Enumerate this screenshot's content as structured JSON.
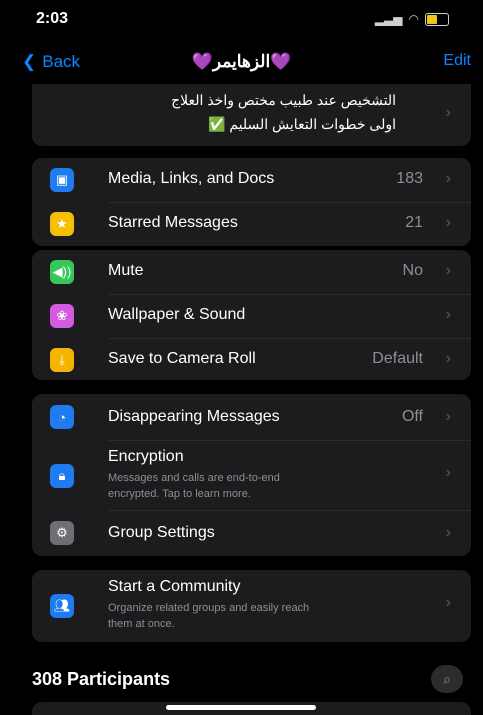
{
  "status": {
    "time": "2:03"
  },
  "nav": {
    "back_label": "Back",
    "title": "💜الزهايمر💜",
    "edit_label": "Edit"
  },
  "description": {
    "line1": "التشخيص عند طبيب مختص واخذ العلاج",
    "line2": "اولى خطوات التعايش السليم ✅"
  },
  "media_section": [
    {
      "label": "Media, Links, and Docs",
      "value": "183",
      "icon": "photo-icon",
      "color": "#1e7cf0"
    },
    {
      "label": "Starred Messages",
      "value": "21",
      "icon": "star-icon",
      "color": "#f5c000"
    }
  ],
  "settings_section": [
    {
      "label": "Mute",
      "value": "No",
      "icon": "speaker-icon",
      "color": "#34c759"
    },
    {
      "label": "Wallpaper & Sound",
      "value": "",
      "icon": "flower-icon",
      "color": "#d25be0"
    },
    {
      "label": "Save to Camera Roll",
      "value": "Default",
      "icon": "download-icon",
      "color": "#f5b400"
    }
  ],
  "privacy_section": [
    {
      "label": "Disappearing Messages",
      "value": "Off",
      "icon": "timer-icon",
      "color": "#1e7cf0"
    },
    {
      "label": "Encryption",
      "sub1": "Messages and calls are end-to-end",
      "sub2": "encrypted. Tap to learn more.",
      "icon": "lock-icon",
      "color": "#1e7cf0"
    },
    {
      "label": "Group Settings",
      "icon": "gear-icon",
      "color": "#6e6e73"
    }
  ],
  "community": {
    "label": "Start a Community",
    "sub1": "Organize related groups and easily reach",
    "sub2": "them at once.",
    "icon": "community-icon",
    "color": "#1e7cf0"
  },
  "participants_label": "308 Participants"
}
